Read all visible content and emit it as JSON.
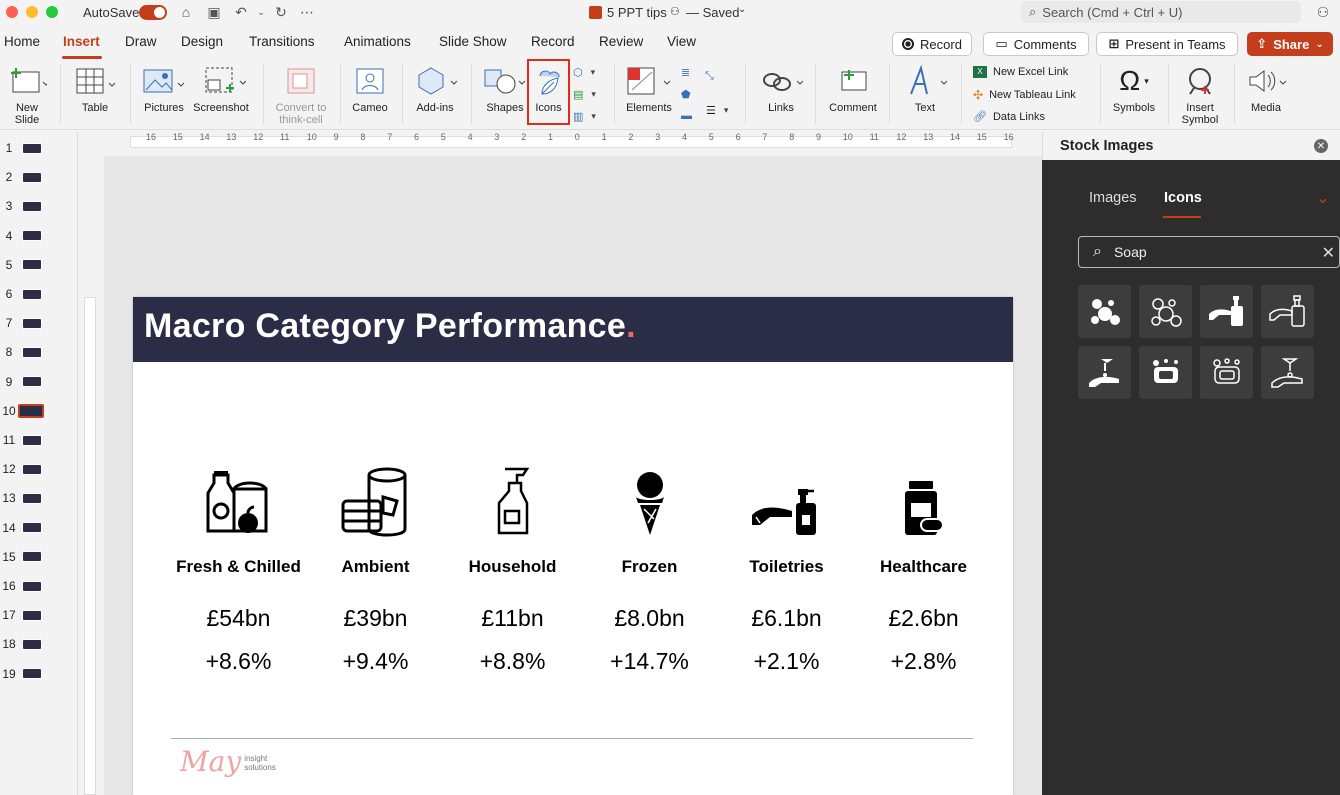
{
  "titlebar": {
    "autosave_label": "AutoSave",
    "document_title": "5 PPT tips",
    "saved_status": "— Saved",
    "search_placeholder": "Search (Cmd + Ctrl + U)"
  },
  "menu": {
    "tabs": [
      "Home",
      "Insert",
      "Draw",
      "Design",
      "Transitions",
      "Animations",
      "Slide Show",
      "Record",
      "Review",
      "View"
    ],
    "active_tab": "Insert",
    "record_button": "Record",
    "comments_button": "Comments",
    "present_button": "Present in Teams",
    "share_button": "Share"
  },
  "ribbon": {
    "new_slide": "New Slide",
    "table": "Table",
    "pictures": "Pictures",
    "screenshot": "Screenshot",
    "convert": "Convert to think-cell",
    "cameo": "Cameo",
    "addins": "Add-ins",
    "shapes": "Shapes",
    "icons": "Icons",
    "elements": "Elements",
    "links": "Links",
    "comment": "Comment",
    "text": "Text",
    "new_excel_link": "New Excel Link",
    "new_tableau_link": "New Tableau Link",
    "data_links": "Data Links",
    "symbols": "Symbols",
    "insert_symbol": "Insert Symbol",
    "media": "Media"
  },
  "ruler": {
    "numbers": [
      "16",
      "15",
      "14",
      "13",
      "12",
      "11",
      "10",
      "9",
      "8",
      "7",
      "6",
      "5",
      "4",
      "3",
      "2",
      "1",
      "0",
      "1",
      "2",
      "3",
      "4",
      "5",
      "6",
      "7",
      "8",
      "9",
      "10",
      "11",
      "12",
      "13",
      "14",
      "15",
      "16"
    ]
  },
  "slides": {
    "numbers": [
      "1",
      "2",
      "3",
      "4",
      "5",
      "6",
      "7",
      "8",
      "9",
      "10",
      "11",
      "12",
      "13",
      "14",
      "15",
      "16",
      "17",
      "18",
      "19"
    ],
    "selected": "10"
  },
  "slide": {
    "title": "Macro Category Performance",
    "title_dot": ".",
    "categories": [
      {
        "name": "Fresh & Chilled",
        "value": "£54bn",
        "growth": "+8.6%",
        "icon": "groceries-icon"
      },
      {
        "name": "Ambient",
        "value": "£39bn",
        "growth": "+9.4%",
        "icon": "canned-food-icon"
      },
      {
        "name": "Household",
        "value": "£11bn",
        "growth": "+8.8%",
        "icon": "spray-bottle-icon"
      },
      {
        "name": "Frozen",
        "value": "£8.0bn",
        "growth": "+14.7%",
        "icon": "ice-cream-icon"
      },
      {
        "name": "Toiletries",
        "value": "£6.1bn",
        "growth": "+2.1%",
        "icon": "hand-soap-icon"
      },
      {
        "name": "Healthcare",
        "value": "£2.6bn",
        "growth": "+2.8%",
        "icon": "medicine-bottle-icon"
      }
    ],
    "logo_script": "May",
    "logo_line1": "insight",
    "logo_line2": "solutions"
  },
  "panel": {
    "title": "Stock Images",
    "tabs": [
      "Images",
      "Icons"
    ],
    "active_tab": "Icons",
    "search_value": "Soap",
    "results": [
      "soap-bubbles-icon",
      "soap-bubbles-outline-icon",
      "soap-dispenser-hand-icon",
      "soap-dispenser-hand-outline-icon",
      "washing-hands-icon",
      "soap-bar-icon",
      "soap-bar-outline-icon",
      "washing-hands-outline-icon"
    ]
  },
  "colors": {
    "accent": "#c43e1c",
    "slide_header": "#2a2d45",
    "highlight_box": "#e02b1b",
    "panel_bg": "#2d2d2d"
  }
}
